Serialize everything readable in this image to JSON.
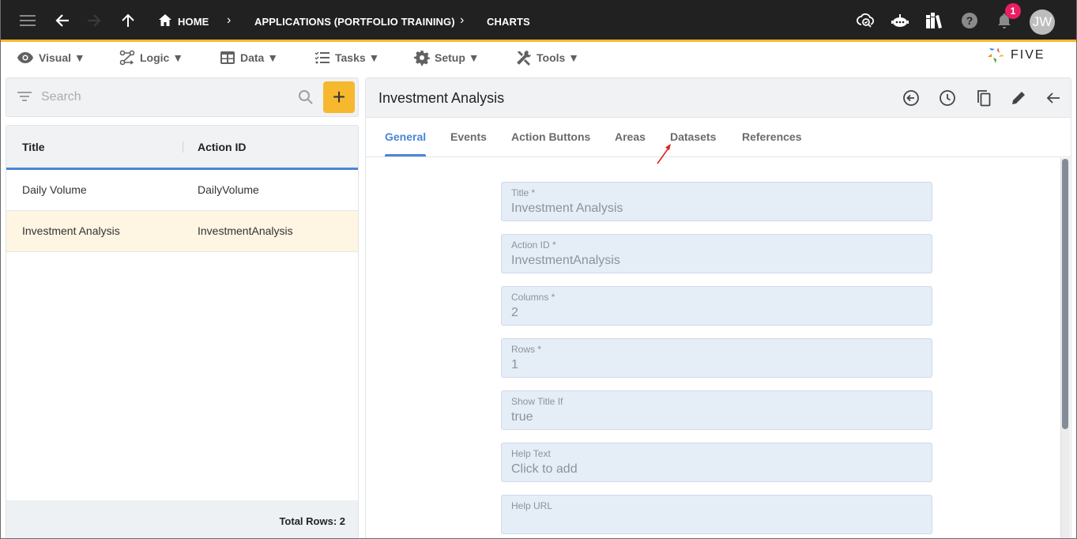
{
  "topbar": {
    "breadcrumb": [
      {
        "label": "HOME",
        "icon": "home-icon"
      },
      {
        "label": "APPLICATIONS (PORTFOLIO TRAINING)"
      },
      {
        "label": "CHARTS"
      }
    ],
    "icons": [
      "menu-icon",
      "back-arrow-icon",
      "forward-arrow-icon",
      "up-arrow-icon",
      "cloud-search-icon",
      "robot-chat-icon",
      "library-books-icon",
      "help-icon",
      "bell-icon"
    ],
    "notification_count": "1",
    "avatar_initials": "JW",
    "accent_color": "#f5b82e"
  },
  "menubar": {
    "items": [
      {
        "label": "Visual ▼",
        "icon": "eye-icon"
      },
      {
        "label": "Logic ▼",
        "icon": "logic-flow-icon"
      },
      {
        "label": "Data ▼",
        "icon": "table-icon"
      },
      {
        "label": "Tasks ▼",
        "icon": "checklist-icon"
      },
      {
        "label": "Setup ▼",
        "icon": "gear-icon"
      },
      {
        "label": "Tools ▼",
        "icon": "tools-icon"
      }
    ],
    "logo_text": "FIVE"
  },
  "left_panel": {
    "search": {
      "placeholder": "Search"
    },
    "add_label": "+",
    "columns": [
      "Title",
      "Action ID"
    ],
    "rows": [
      {
        "title": "Daily Volume",
        "action_id": "DailyVolume",
        "selected": false
      },
      {
        "title": "Investment Analysis",
        "action_id": "InvestmentAnalysis",
        "selected": true
      }
    ],
    "total_rows": "Total Rows: 2",
    "header_accent": "#4a86d6"
  },
  "right_panel": {
    "title": "Investment Analysis",
    "actions": [
      "revert-icon",
      "history-icon",
      "copy-icon",
      "edit-icon",
      "back-icon"
    ],
    "tabs": [
      {
        "label": "General",
        "active": true
      },
      {
        "label": "Events",
        "active": false
      },
      {
        "label": "Action Buttons",
        "active": false
      },
      {
        "label": "Areas",
        "active": false
      },
      {
        "label": "Datasets",
        "active": false
      },
      {
        "label": "References",
        "active": false
      }
    ],
    "fields": [
      {
        "label": "Title *",
        "value": "Investment Analysis"
      },
      {
        "label": "Action ID *",
        "value": "InvestmentAnalysis"
      },
      {
        "label": "Columns *",
        "value": "2"
      },
      {
        "label": "Rows *",
        "value": "1"
      },
      {
        "label": "Show Title If",
        "value": "true"
      },
      {
        "label": "Help Text",
        "value": "Click to add"
      },
      {
        "label": "Help URL",
        "value": ""
      }
    ]
  }
}
